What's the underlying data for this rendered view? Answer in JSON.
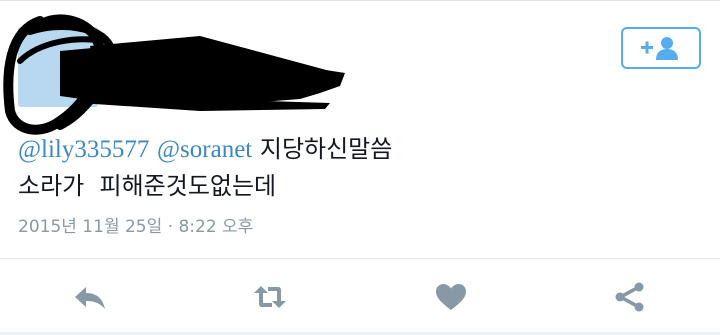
{
  "tweet": {
    "mention_1": "@lily335577",
    "mention_2": "@soranet",
    "text_line1_rest": " 지당하신말씀",
    "text_line2": "소라가  피해준것도없는데",
    "timestamp": "2015년 11월 25일 · 8:22 오후"
  },
  "icons": {
    "follow": "add-user-icon",
    "reply": "reply-icon",
    "retweet": "retweet-icon",
    "like": "heart-icon",
    "share": "share-icon"
  },
  "colors": {
    "accent": "#55acee",
    "mention": "#3b88c3",
    "muted": "#8899a6"
  }
}
